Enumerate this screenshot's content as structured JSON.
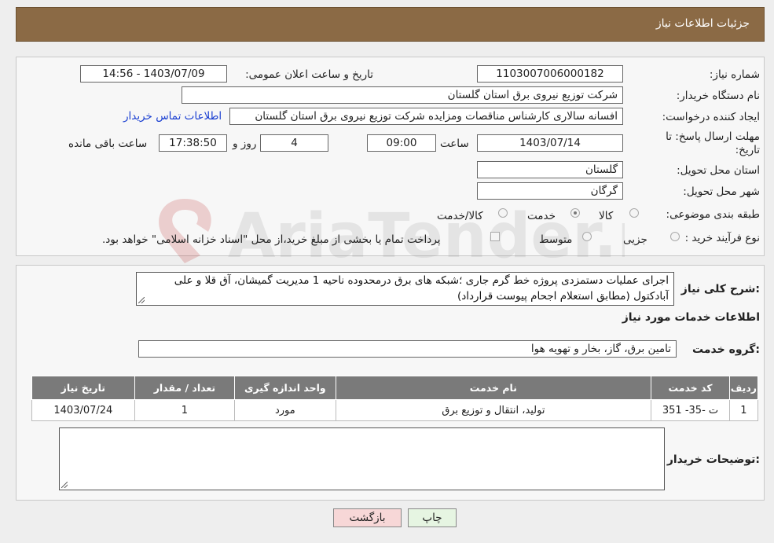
{
  "header": {
    "title": "جزئيات اطلاعات نياز"
  },
  "fields": {
    "need_number_label": "شماره نیاز:",
    "need_number": "1103007006000182",
    "announce_label": "تاریخ و ساعت اعلان عمومی:",
    "announce_value": "1403/07/09 - 14:56",
    "buyer_org_label": "نام دستگاه خریدار:",
    "buyer_org": "شرکت توزیع نیروی برق استان گلستان",
    "creator_label": "ایجاد کننده درخواست:",
    "creator": "افسانه سالاری کارشناس مناقصات ومزایده شرکت توزیع نیروی برق استان گلستان",
    "contact_link": "اطلاعات تماس خریدار",
    "deadline_label": "مهلت ارسال پاسخ: تا",
    "deadline_label2": "تاریخ:",
    "deadline_date": "1403/07/14",
    "time_label": "ساعت",
    "deadline_time": "09:00",
    "days_value": "4",
    "days_label": "روز و",
    "remaining_time": "17:38:50",
    "remaining_label": "ساعت باقی مانده",
    "province_label": "استان محل تحویل:",
    "province": "گلستان",
    "city_label": "شهر محل تحویل:",
    "city": "گرگان",
    "category_label": "طبقه بندی موضوعی:",
    "category_options": [
      "کالا",
      "خدمت",
      "کالا/خدمت"
    ],
    "category_selected": "خدمت",
    "process_label": "نوع فرآیند خرید :",
    "process_options": [
      "جزیی",
      "متوسط"
    ],
    "payment_note": "پرداخت تمام یا بخشی از مبلغ خرید،از محل \"اسناد خزانه اسلامی\" خواهد بود."
  },
  "description": {
    "label": "شرح کلی نیاز:",
    "text": "اجرای عملیات دستمزدی پروژه خط گرم جاری  ؛شبکه های برق درمحدوده ناحیه 1 مدیریت گمیشان، آق قلا و علی آبادکتول (مطابق استعلام اجحام پیوست  قرارداد)"
  },
  "services": {
    "section_title": "اطلاعات خدمات مورد نیاز",
    "group_label": "گروه خدمت:",
    "group_value": "تامین برق، گاز، بخار و تهویه هوا",
    "columns": [
      "ردیف",
      "کد خدمت",
      "نام خدمت",
      "واحد اندازه گیری",
      "تعداد / مقدار",
      "تاریخ نیاز"
    ],
    "rows": [
      [
        "1",
        "ت -35- 351",
        "تولید، انتقال و توزیع برق",
        "مورد",
        "1",
        "1403/07/24"
      ]
    ]
  },
  "buyer_notes": {
    "label": "توضیحات خریدار:",
    "value": ""
  },
  "buttons": {
    "print": "چاپ",
    "back": "بازگشت"
  },
  "watermark": {
    "text": "AriaTender.neT"
  },
  "colors": {
    "header": "#8b6a45",
    "table_header": "#7a7a7a",
    "link": "#1a3fd1",
    "back_button": "#f7d7d7"
  }
}
